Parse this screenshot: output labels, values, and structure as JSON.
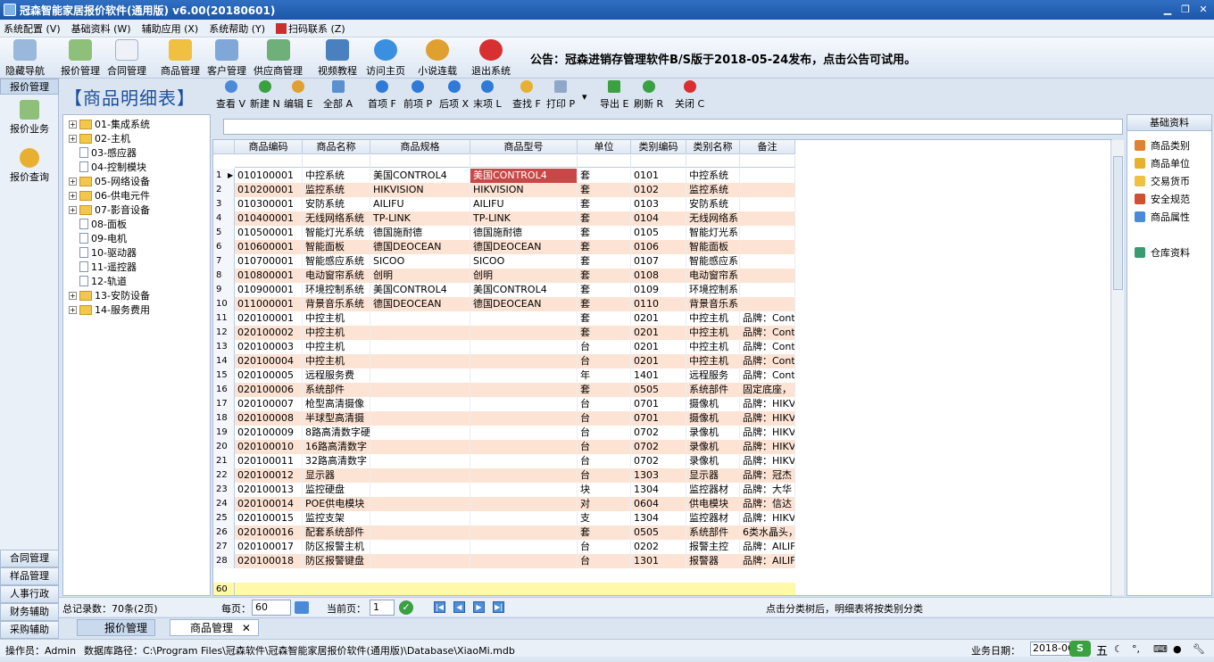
{
  "window": {
    "title": "冠森智能家居报价软件(通用版) v6.00(20180601)"
  },
  "menu": [
    "系统配置 (V)",
    "基础资料 (W)",
    "辅助应用 (X)",
    "系统帮助 (Y)",
    "扫码联系 (Z)"
  ],
  "toolbar": {
    "items": [
      "隐藏导航",
      "报价管理",
      "合同管理",
      "商品管理",
      "客户管理",
      "供应商管理",
      "视频教程",
      "访问主页",
      "小说连载",
      "退出系统"
    ],
    "notice": "公告：冠森进销存管理软件B/S版于2018-05-24发布，点击公告可试用。"
  },
  "left_nav": {
    "title": "报价管理",
    "items": [
      "报价业务",
      "报价查询"
    ],
    "bottom": [
      "合同管理",
      "样品管理",
      "人事行政",
      "财务辅助",
      "采购辅助"
    ]
  },
  "page": {
    "title": "【商品明细表】"
  },
  "subtoolbar": [
    "查看 V",
    "新建 N",
    "编辑 E",
    "全部 A",
    "首项 F",
    "前项 P",
    "后项 X",
    "末项 L",
    "查找 F",
    "打印 P",
    "导出 E",
    "刷新 R",
    "关闭 C"
  ],
  "tree": [
    {
      "label": "01-集成系统",
      "type": "folder"
    },
    {
      "label": "02-主机",
      "type": "folder"
    },
    {
      "label": "03-感应器",
      "type": "doc"
    },
    {
      "label": "04-控制模块",
      "type": "doc"
    },
    {
      "label": "05-网络设备",
      "type": "folder"
    },
    {
      "label": "06-供电元件",
      "type": "folder"
    },
    {
      "label": "07-影音设备",
      "type": "folder"
    },
    {
      "label": "08-面板",
      "type": "doc"
    },
    {
      "label": "09-电机",
      "type": "doc"
    },
    {
      "label": "10-驱动器",
      "type": "doc"
    },
    {
      "label": "11-遥控器",
      "type": "doc"
    },
    {
      "label": "12-轨道",
      "type": "doc"
    },
    {
      "label": "13-安防设备",
      "type": "folder"
    },
    {
      "label": "14-服务费用",
      "type": "folder"
    }
  ],
  "grid": {
    "columns": [
      "商品编码",
      "商品名称",
      "商品规格",
      "商品型号",
      "单位",
      "类别编码",
      "类别名称",
      "备注"
    ],
    "rows": [
      [
        "1",
        "010100001",
        "中控系统",
        "美国CONTROL4",
        "美国CONTROL4",
        "套",
        "0101",
        "中控系统",
        ""
      ],
      [
        "2",
        "010200001",
        "监控系统",
        "HIKVISION",
        "HIKVISION",
        "套",
        "0102",
        "监控系统",
        ""
      ],
      [
        "3",
        "010300001",
        "安防系统",
        "AILIFU",
        "AILIFU",
        "套",
        "0103",
        "安防系统",
        ""
      ],
      [
        "4",
        "010400001",
        "无线网络系统",
        "TP-LINK",
        "TP-LINK",
        "套",
        "0104",
        "无线网络系",
        ""
      ],
      [
        "5",
        "010500001",
        "智能灯光系统",
        "德国施耐德",
        "德国施耐德",
        "套",
        "0105",
        "智能灯光系",
        ""
      ],
      [
        "6",
        "010600001",
        "智能面板",
        "德国DEOCEAN",
        "德国DEOCEAN",
        "套",
        "0106",
        "智能面板",
        ""
      ],
      [
        "7",
        "010700001",
        "智能感应系统",
        "SICOO",
        "SICOO",
        "套",
        "0107",
        "智能感应系",
        ""
      ],
      [
        "8",
        "010800001",
        "电动窗帘系统",
        "创明",
        "创明",
        "套",
        "0108",
        "电动窗帘系",
        ""
      ],
      [
        "9",
        "010900001",
        "环境控制系统",
        "美国CONTROL4",
        "美国CONTROL4",
        "套",
        "0109",
        "环境控制系",
        ""
      ],
      [
        "10",
        "011000001",
        "背景音乐系统",
        "德国DEOCEAN",
        "德国DEOCEAN",
        "套",
        "0110",
        "背景音乐系",
        ""
      ],
      [
        "11",
        "020100001",
        "中控主机",
        "",
        "",
        "套",
        "0201",
        "中控主机",
        "品牌：Cont"
      ],
      [
        "12",
        "020100002",
        "中控主机",
        "",
        "",
        "套",
        "0201",
        "中控主机",
        "品牌：Cont"
      ],
      [
        "13",
        "020100003",
        "中控主机",
        "",
        "",
        "台",
        "0201",
        "中控主机",
        "品牌：Cont"
      ],
      [
        "14",
        "020100004",
        "中控主机",
        "",
        "",
        "台",
        "0201",
        "中控主机",
        "品牌：Cont"
      ],
      [
        "15",
        "020100005",
        "远程服务费",
        "",
        "",
        "年",
        "1401",
        "远程服务",
        "品牌：Cont"
      ],
      [
        "16",
        "020100006",
        "系统部件",
        "",
        "",
        "套",
        "0505",
        "系统部件",
        "固定底座，"
      ],
      [
        "17",
        "020100007",
        "枪型高清摄像",
        "",
        "",
        "台",
        "0701",
        "摄像机",
        "品牌：HIKV"
      ],
      [
        "18",
        "020100008",
        "半球型高清摄",
        "",
        "",
        "台",
        "0701",
        "摄像机",
        "品牌：HIKV"
      ],
      [
        "19",
        "020100009",
        "8路高清数字硬",
        "",
        "",
        "台",
        "0702",
        "录像机",
        "品牌：HIKV"
      ],
      [
        "20",
        "020100010",
        "16路高清数字",
        "",
        "",
        "台",
        "0702",
        "录像机",
        "品牌：HIKV"
      ],
      [
        "21",
        "020100011",
        "32路高清数字",
        "",
        "",
        "台",
        "0702",
        "录像机",
        "品牌：HIKV"
      ],
      [
        "22",
        "020100012",
        "显示器",
        "",
        "",
        "台",
        "1303",
        "显示器",
        "品牌：冠杰"
      ],
      [
        "23",
        "020100013",
        "监控硬盘",
        "",
        "",
        "块",
        "1304",
        "监控器材",
        "品牌：大华"
      ],
      [
        "24",
        "020100014",
        "POE供电模块",
        "",
        "",
        "对",
        "0604",
        "供电模块",
        "品牌：信达"
      ],
      [
        "25",
        "020100015",
        "监控支架",
        "",
        "",
        "支",
        "1304",
        "监控器材",
        "品牌：HIKV"
      ],
      [
        "26",
        "020100016",
        "配套系统部件",
        "",
        "",
        "套",
        "0505",
        "系统部件",
        "6类水晶头，"
      ],
      [
        "27",
        "020100017",
        "防区报警主机",
        "",
        "",
        "台",
        "0202",
        "报警主控",
        "品牌：AILIF"
      ],
      [
        "28",
        "020100018",
        "防区报警键盘",
        "",
        "",
        "台",
        "1301",
        "报警器",
        "品牌：AILIF"
      ]
    ],
    "last_row_label": "60"
  },
  "right_panel": {
    "title": "基础资料",
    "items": [
      "商品类别",
      "商品单位",
      "交易货币",
      "安全规范",
      "商品属性",
      "仓库资料"
    ]
  },
  "pager": {
    "total": "总记录数：70条(2页)",
    "per_page_label": "每页：",
    "per_page": "60",
    "current_label": "当前页：",
    "current": "1",
    "hint": "点击分类树后，明细表将按类别分类"
  },
  "tabs": [
    "报价管理",
    "商品管理"
  ],
  "status": {
    "operator": "操作员：Admin",
    "db_path": "数据库路径：C:\\Program Files\\冠森软件\\冠森智能家居报价软件(通用版)\\Database\\XiaoMi.mdb",
    "date_label": "业务日期：",
    "date": "2018-06"
  },
  "colors": {
    "title_bar": "#1c56a8",
    "row_alt": "#fde3d4",
    "selected": "#c84848",
    "last_row": "#fff9a8"
  }
}
